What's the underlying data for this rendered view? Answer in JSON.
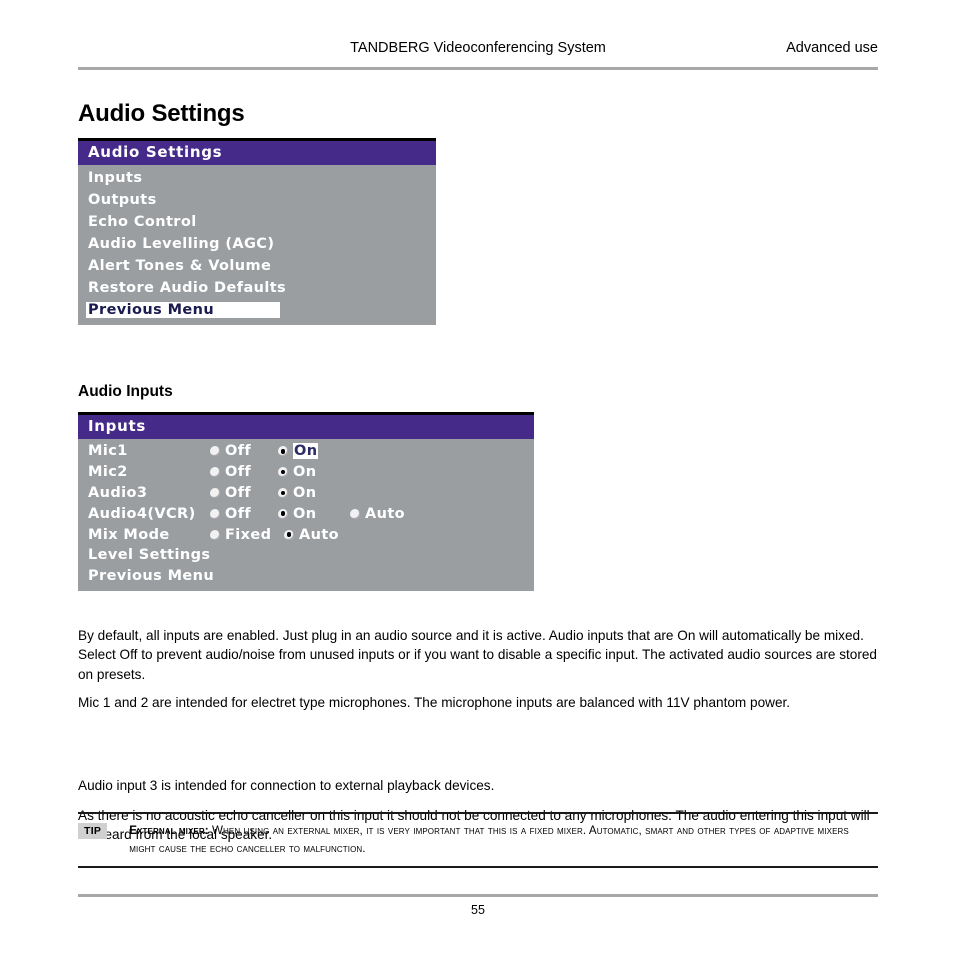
{
  "header": {
    "center": "TANDBERG Videoconferencing System",
    "right": "Advanced use"
  },
  "page_title": "Audio Settings",
  "section_title": "Audio Inputs",
  "colors": {
    "osd_title_bar": "#452a8a",
    "osd_body": "#9a9ea1",
    "osd_text": "#ffffff",
    "highlight_bg": "#ffffff",
    "highlight_text": "#1b1b4f",
    "rule_gray": "#a8a8a8",
    "tip_badge_bg": "#d0d0d0"
  },
  "audio_settings_menu": {
    "title": "Audio Settings",
    "items": [
      {
        "label": "Inputs",
        "highlighted": false
      },
      {
        "label": "Outputs",
        "highlighted": false
      },
      {
        "label": "Echo Control",
        "highlighted": false
      },
      {
        "label": "Audio Levelling (AGC)",
        "highlighted": false
      },
      {
        "label": "Alert Tones & Volume",
        "highlighted": false
      },
      {
        "label": "Restore Audio Defaults",
        "highlighted": false
      },
      {
        "label": "Previous Menu",
        "highlighted": true
      }
    ]
  },
  "inputs_menu": {
    "title": "Inputs",
    "rows": [
      {
        "name": "Mic1",
        "options": [
          {
            "label": "Off",
            "selected": false,
            "highlighted": false
          },
          {
            "label": "On",
            "selected": true,
            "highlighted": true
          }
        ]
      },
      {
        "name": "Mic2",
        "options": [
          {
            "label": "Off",
            "selected": false,
            "highlighted": false
          },
          {
            "label": "On",
            "selected": true,
            "highlighted": false
          }
        ]
      },
      {
        "name": "Audio3",
        "options": [
          {
            "label": "Off",
            "selected": false,
            "highlighted": false
          },
          {
            "label": "On",
            "selected": true,
            "highlighted": false
          }
        ]
      },
      {
        "name": "Audio4(VCR)",
        "options": [
          {
            "label": "Off",
            "selected": false,
            "highlighted": false
          },
          {
            "label": "On",
            "selected": true,
            "highlighted": false
          },
          {
            "label": "Auto",
            "selected": false,
            "highlighted": false
          }
        ]
      },
      {
        "name": "Mix Mode",
        "options": [
          {
            "label": "Fixed",
            "selected": false,
            "highlighted": false
          },
          {
            "label": "Auto",
            "selected": true,
            "highlighted": false
          }
        ]
      },
      {
        "name": "Level Settings",
        "options": []
      },
      {
        "name": "Previous Menu",
        "options": []
      }
    ]
  },
  "paragraphs": {
    "p1": "By default, all inputs are enabled. Just plug in an audio source and it is active. Audio inputs that are On will automatically be mixed. Select Off to prevent audio/noise from unused inputs or if you want to disable a specific input. The activated audio sources are stored on presets.",
    "p2": "Mic 1 and 2 are intended for electret type microphones. The microphone inputs are balanced with 11V phantom power.",
    "p3": "Audio input 3 is intended for connection to external playback devices.",
    "p4": "As there is no acoustic echo canceller on this input it should not be connected to any microphones. The audio entering this input will be heard from the local speaker."
  },
  "tip": {
    "badge": "TIP",
    "lead": "External mixer:",
    "text": " When using an external mixer, it is very important that this is a fixed mixer. Automatic, smart and other types of adaptive mixers might cause the echo canceller to malfunction."
  },
  "footer": {
    "page_number": "55"
  }
}
